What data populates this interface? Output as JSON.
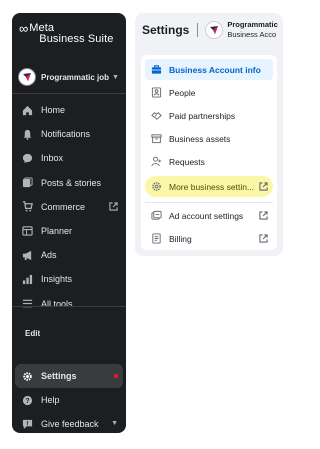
{
  "brand": {
    "symbol": "∞",
    "line1": "Meta",
    "line2": "Business Suite"
  },
  "sidebar": {
    "account_name": "Programmatic job...",
    "items": [
      {
        "label": "Home",
        "icon": "home-icon"
      },
      {
        "label": "Notifications",
        "icon": "bell-icon"
      },
      {
        "label": "Inbox",
        "icon": "chat-bubble-icon"
      },
      {
        "label": "Posts & stories",
        "icon": "posts-icon"
      },
      {
        "label": "Commerce",
        "icon": "cart-icon",
        "external": true
      },
      {
        "label": "Planner",
        "icon": "calendar-icon"
      },
      {
        "label": "Ads",
        "icon": "megaphone-icon"
      },
      {
        "label": "Insights",
        "icon": "bar-chart-icon"
      },
      {
        "label": "All tools",
        "icon": "menu-icon"
      }
    ],
    "edit_label": "Edit",
    "bottom": [
      {
        "label": "Settings",
        "icon": "gear-icon",
        "active": true
      },
      {
        "label": "Help",
        "icon": "help-icon"
      },
      {
        "label": "Give feedback",
        "icon": "feedback-icon"
      }
    ]
  },
  "settings": {
    "title": "Settings",
    "account_line1": "Programmatic",
    "account_line2": "Business Acco",
    "menu": [
      {
        "label": "Business Account info",
        "icon": "briefcase-icon",
        "active": true
      },
      {
        "label": "People",
        "icon": "people-icon"
      },
      {
        "label": "Paid partnerships",
        "icon": "handshake-icon"
      },
      {
        "label": "Business assets",
        "icon": "assets-icon"
      },
      {
        "label": "Requests",
        "icon": "person-add-icon"
      },
      {
        "label": "More business settin...",
        "icon": "gear-icon",
        "highlight": true,
        "external": true
      },
      {
        "label": "Ad account settings",
        "icon": "ad-account-icon",
        "external": true
      },
      {
        "label": "Billing",
        "icon": "billing-icon",
        "external": true
      }
    ]
  },
  "colors": {
    "sidebar_bg": "#1c1e21",
    "accent": "#0064d1",
    "highlight": "#fbf7a8",
    "notification_dot": "#e41e3f"
  }
}
